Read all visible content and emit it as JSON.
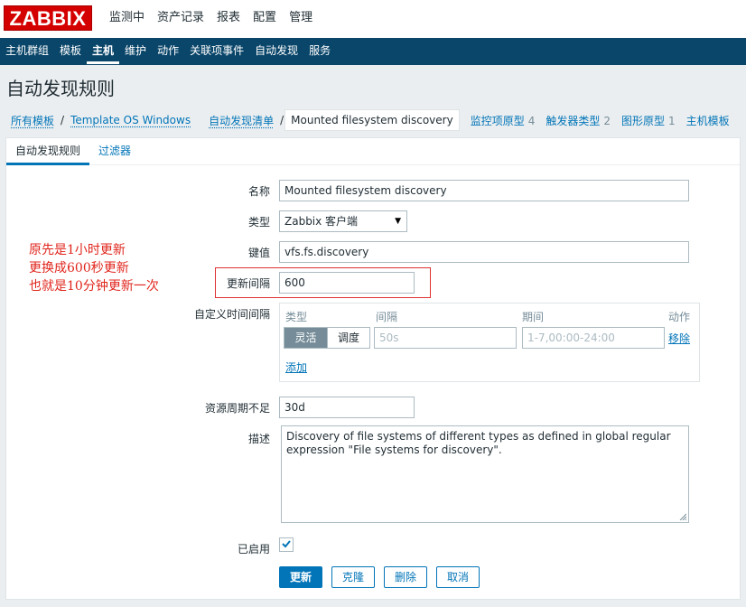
{
  "logo": "ZABBIX",
  "main_menu": [
    "监测中",
    "资产记录",
    "报表",
    "配置",
    "管理"
  ],
  "sub_menu": [
    "主机群组",
    "模板",
    "主机",
    "维护",
    "动作",
    "关联项事件",
    "自动发现",
    "服务"
  ],
  "page_title": "自动发现规则",
  "breadcrumbs": {
    "all_templates": "所有模板",
    "template": "Template OS Windows",
    "discovery_list": "自动发现清单",
    "current": "Mounted filesystem discovery",
    "item_prototypes": "监控项原型",
    "item_prototypes_count": "4",
    "trigger_prototypes": "触发器类型",
    "trigger_prototypes_count": "2",
    "graph_prototypes": "图形原型",
    "graph_prototypes_count": "1",
    "host_prototypes": "主机模板"
  },
  "tabs": [
    "自动发现规则",
    "过滤器"
  ],
  "form": {
    "name_label": "名称",
    "name_value": "Mounted filesystem discovery",
    "type_label": "类型",
    "type_value": "Zabbix 客户端",
    "key_label": "键值",
    "key_value": "vfs.fs.discovery",
    "interval_label": "更新间隔",
    "interval_value": "600",
    "custom_label": "自定义时间间隔",
    "custom": {
      "col_type": "类型",
      "col_interval": "间隔",
      "col_period": "期间",
      "col_action": "动作",
      "btn_flexible": "灵活",
      "btn_scheduling": "调度",
      "interval_placeholder": "50s",
      "period_placeholder": "1-7,00:00-24:00",
      "remove": "移除",
      "add": "添加"
    },
    "lifetime_label": "资源周期不足",
    "lifetime_value": "30d",
    "desc_label": "描述",
    "desc_value": "Discovery of file systems of different types as defined in global regular expression \"File systems for discovery\".",
    "enabled_label": "已启用",
    "enabled": true
  },
  "buttons": {
    "update": "更新",
    "clone": "克隆",
    "delete": "删除",
    "cancel": "取消"
  },
  "annotation": [
    "原先是1小时更新",
    "更换成600秒更新",
    "也就是10分钟更新一次"
  ],
  "colors": {
    "accent": "#0275b8",
    "header_bg": "#0a466a",
    "logo_red": "#d40000",
    "annotation_red": "#e0251c"
  }
}
